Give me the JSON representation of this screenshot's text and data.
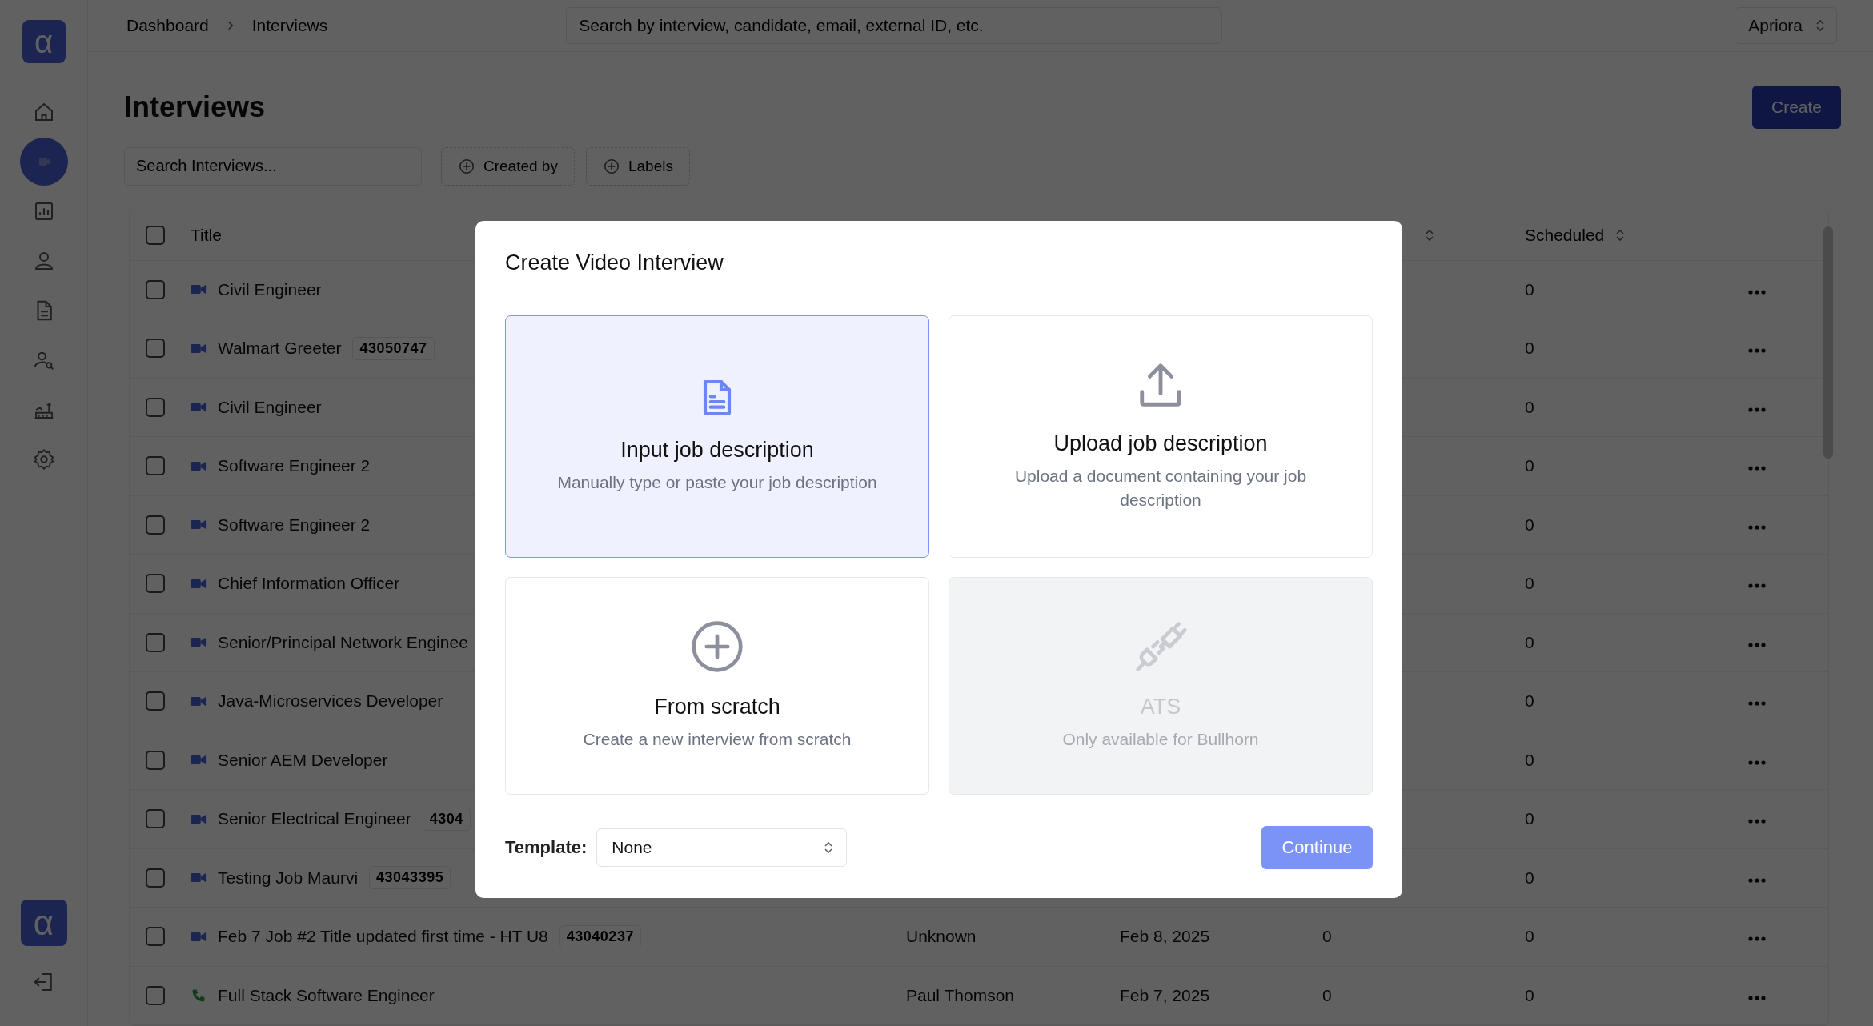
{
  "sidebar": {
    "logo": "α",
    "items": [
      {
        "kind": "home",
        "selected": false
      },
      {
        "kind": "interviews",
        "selected": true
      },
      {
        "kind": "chart",
        "selected": false
      },
      {
        "kind": "person",
        "selected": false
      },
      {
        "kind": "document",
        "selected": false
      },
      {
        "kind": "person-search",
        "selected": false
      },
      {
        "kind": "factory",
        "selected": false
      },
      {
        "kind": "settings",
        "selected": false
      }
    ],
    "bottom_logo": "α"
  },
  "topbar": {
    "breadcrumb": [
      "Dashboard",
      "Interviews"
    ],
    "search": {
      "placeholder": "Search by interview, candidate, email, external ID, etc."
    },
    "organization": "Apriora"
  },
  "page": {
    "title": "Interviews",
    "create_button": "Create",
    "search": {
      "placeholder": "Search Interviews..."
    },
    "filters": [
      "Created by",
      "Labels"
    ]
  },
  "table": {
    "header_checked": false,
    "columns": [
      "Title",
      "Scheduled"
    ],
    "rows": [
      {
        "kind": "video",
        "checked": false,
        "title": "Civil Engineer",
        "scheduled": "0"
      },
      {
        "kind": "video",
        "checked": false,
        "title": "Walmart Greeter",
        "badge": "43050747",
        "scheduled": "0"
      },
      {
        "kind": "video",
        "checked": false,
        "title": "Civil Engineer",
        "scheduled": "0"
      },
      {
        "kind": "video",
        "checked": false,
        "title": "Software Engineer 2",
        "scheduled": "0"
      },
      {
        "kind": "video",
        "checked": false,
        "title": "Software Engineer 2",
        "scheduled": "0"
      },
      {
        "kind": "video",
        "checked": false,
        "title": "Chief Information Officer",
        "scheduled": "0"
      },
      {
        "kind": "video",
        "checked": false,
        "title": "Senior/Principal Network Enginee",
        "scheduled": "0"
      },
      {
        "kind": "video",
        "checked": false,
        "title": "Java-Microservices Developer",
        "scheduled": "0"
      },
      {
        "kind": "video",
        "checked": false,
        "title": "Senior AEM Developer",
        "scheduled": "0"
      },
      {
        "kind": "video",
        "checked": false,
        "title": "Senior Electrical Engineer",
        "badge": "4304",
        "scheduled": "0"
      },
      {
        "kind": "video",
        "checked": false,
        "title": "Testing Job Maurvi",
        "badge": "43043395",
        "scheduled": "0"
      },
      {
        "kind": "video",
        "checked": false,
        "title": "Feb 7 Job #2 Title updated first time - HT U8",
        "badge": "43040237",
        "created_by": "Unknown",
        "date": "Feb 8, 2025",
        "count": "0",
        "scheduled": "0"
      },
      {
        "kind": "phone",
        "checked": false,
        "title": "Full Stack Software Engineer",
        "created_by": "Paul Thomson",
        "date": "Feb 7, 2025",
        "count": "0",
        "scheduled": "0"
      }
    ]
  },
  "modal": {
    "title": "Create Video Interview",
    "options": [
      {
        "kind": "document",
        "title": "Input job description",
        "description": "Manually type or paste your job description",
        "selected": true,
        "disabled": false
      },
      {
        "kind": "upload",
        "title": "Upload job description",
        "description": "Upload a document containing your job description",
        "selected": false,
        "disabled": false
      },
      {
        "kind": "plus",
        "title": "From scratch",
        "description": "Create a new interview from scratch",
        "selected": false,
        "disabled": false
      },
      {
        "kind": "plug",
        "title": "ATS",
        "description": "Only available for Bullhorn",
        "selected": false,
        "disabled": true
      }
    ],
    "template_label": "Template:",
    "template_value": "None",
    "continue_button": "Continue"
  }
}
